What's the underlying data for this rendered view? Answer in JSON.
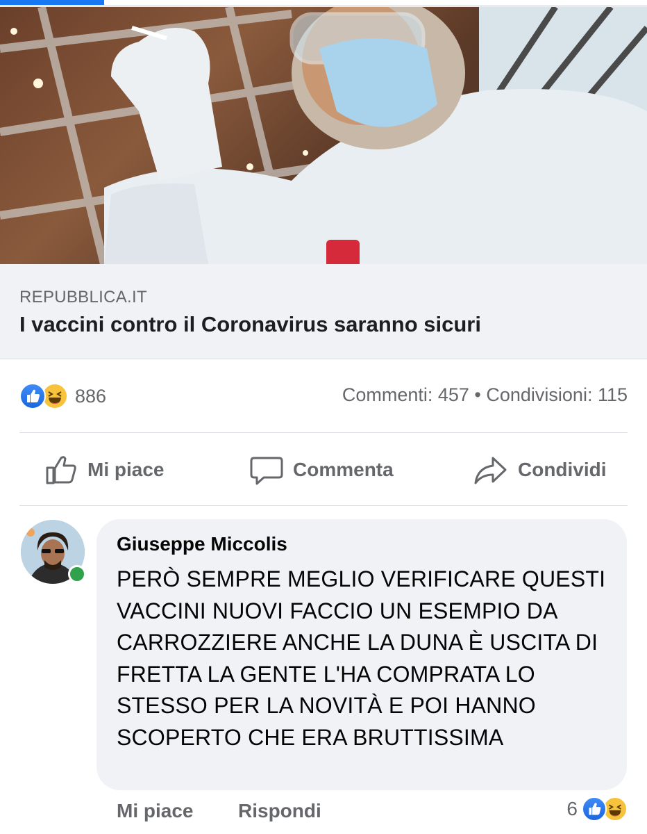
{
  "link_preview": {
    "domain": "REPUBBLICA.IT",
    "title": "I vaccini contro il Coronavirus saranno sicuri"
  },
  "post_stats": {
    "reaction_count": "886",
    "reactions": [
      "like-icon",
      "haha-icon"
    ],
    "comments_shares": "Commenti: 457 • Condivisioni: 115"
  },
  "actions": {
    "like": "Mi piace",
    "comment": "Commenta",
    "share": "Condividi"
  },
  "comment": {
    "author": "Giuseppe Miccolis",
    "text": "PERÒ SEMPRE MEGLIO VERIFICARE QUESTI VACCINI NUOVI FACCIO UN ESEMPIO DA CARROZZIERE ANCHE LA DUNA È USCITA DI FRETTA LA GENTE L'HA COMPRATA LO STESSO PER LA NOVITÀ E POI HANNO SCOPERTO CHE ERA BRUTTISSIMA",
    "like_label": "Mi piace",
    "reply_label": "Rispondi",
    "reaction_count": "6"
  },
  "colors": {
    "accent": "#1877f2",
    "online": "#31a24c",
    "haha": "#f7c23c"
  }
}
